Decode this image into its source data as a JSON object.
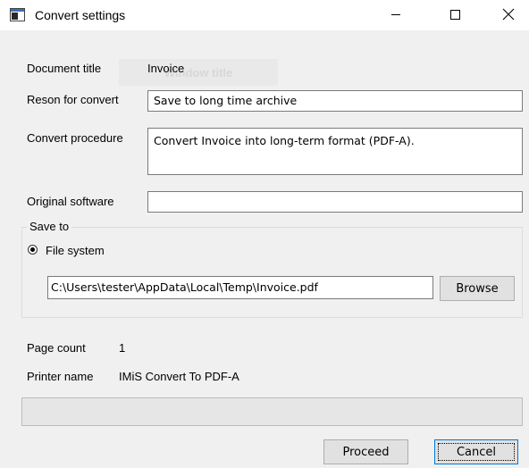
{
  "window": {
    "title": "Convert settings",
    "icon": "app-window-icon",
    "controls": [
      "minimize-icon",
      "maximize-icon",
      "close-icon"
    ]
  },
  "background_ghost_text": "Window title",
  "form": {
    "document_title_label": "Document title",
    "document_title_value": "Invoice",
    "reason_label": "Reson for convert",
    "reason_value": "Save to long time archive",
    "procedure_label": "Convert procedure",
    "procedure_value": "Convert Invoice into long-term format (PDF-A).",
    "original_software_label": "Original software",
    "original_software_value": ""
  },
  "save_to": {
    "legend": "Save to",
    "option_label": "File system",
    "option_selected": true,
    "path_value": "C:\\Users\\tester\\AppData\\Local\\Temp\\Invoice.pdf",
    "browse_label": "Browse"
  },
  "info": {
    "page_count_label": "Page count",
    "page_count_value": "1",
    "printer_name_label": "Printer name",
    "printer_name_value": "IMiS Convert To PDF-A"
  },
  "progress": {
    "value": 0
  },
  "buttons": {
    "proceed_label": "Proceed",
    "cancel_label": "Cancel"
  },
  "colors": {
    "window_bg": "#f0f0f0",
    "focus_border": "#0078d7",
    "button_bg": "#e1e1e1"
  }
}
